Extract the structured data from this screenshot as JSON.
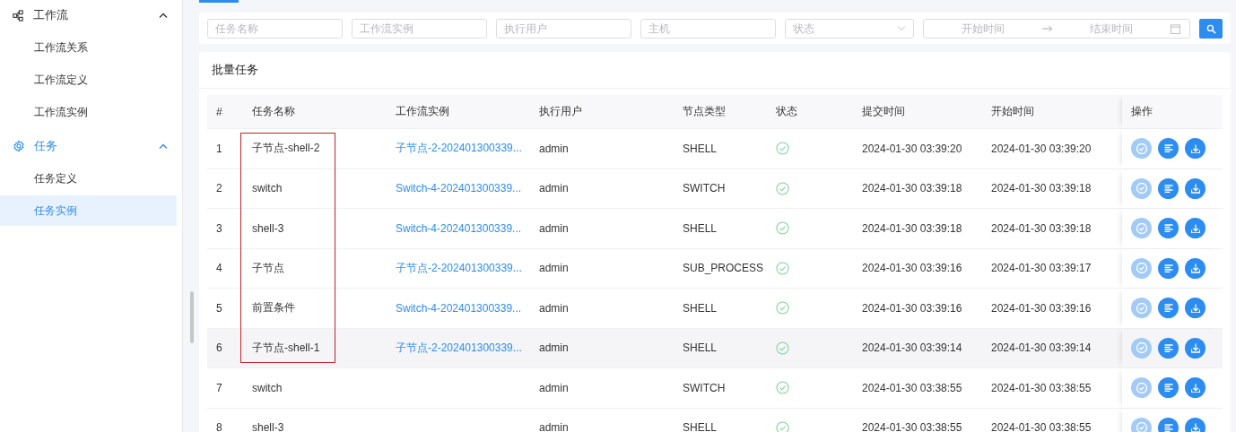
{
  "sidebar": {
    "groups": [
      {
        "label": "工作流",
        "expanded": true,
        "active": false,
        "children": [
          {
            "label": "工作流关系",
            "selected": false
          },
          {
            "label": "工作流定义",
            "selected": false
          },
          {
            "label": "工作流实例",
            "selected": false
          }
        ]
      },
      {
        "label": "任务",
        "expanded": true,
        "active": true,
        "children": [
          {
            "label": "任务定义",
            "selected": false
          },
          {
            "label": "任务实例",
            "selected": true
          }
        ]
      }
    ]
  },
  "filters": [
    {
      "kind": "text",
      "placeholder": "任务名称"
    },
    {
      "kind": "text",
      "placeholder": "工作流实例"
    },
    {
      "kind": "text",
      "placeholder": "执行用户"
    },
    {
      "kind": "text",
      "placeholder": "主机"
    },
    {
      "kind": "select",
      "placeholder": "状态"
    },
    {
      "kind": "daterange",
      "start_placeholder": "开始时间",
      "end_placeholder": "结束时间"
    }
  ],
  "table": {
    "title": "批量任务",
    "columns": [
      {
        "kind": "text",
        "label": "#"
      },
      {
        "kind": "text",
        "label": "任务名称"
      },
      {
        "kind": "text",
        "label": "工作流实例"
      },
      {
        "kind": "text",
        "label": "执行用户"
      },
      {
        "kind": "text",
        "label": "节点类型"
      },
      {
        "kind": "text",
        "label": "状态"
      },
      {
        "kind": "text",
        "label": "提交时间"
      },
      {
        "kind": "text",
        "label": "开始时间"
      },
      {
        "kind": "clipped"
      },
      {
        "kind": "text",
        "label": "操作"
      }
    ],
    "rows": [
      {
        "index": "1",
        "name": "子节点-shell-2",
        "instance": "子节点-2-202401300339...",
        "user": "admin",
        "node_type": "SHELL",
        "success": true,
        "submit_time": "2024-01-30 03:39:20",
        "start_time": "2024-01-30 03:39:20",
        "marked": true,
        "hovered": false,
        "actions": [
          {
            "kind": "confirm",
            "disabled": true
          },
          {
            "kind": "log",
            "disabled": false
          },
          {
            "kind": "download",
            "disabled": false
          }
        ]
      },
      {
        "index": "2",
        "name": "switch",
        "instance": "Switch-4-202401300339...",
        "user": "admin",
        "node_type": "SWITCH",
        "success": true,
        "submit_time": "2024-01-30 03:39:18",
        "start_time": "2024-01-30 03:39:18",
        "marked": true,
        "hovered": false,
        "actions": [
          {
            "kind": "confirm",
            "disabled": true
          },
          {
            "kind": "log",
            "disabled": false
          },
          {
            "kind": "download",
            "disabled": false
          }
        ]
      },
      {
        "index": "3",
        "name": "shell-3",
        "instance": "Switch-4-202401300339...",
        "user": "admin",
        "node_type": "SHELL",
        "success": true,
        "submit_time": "2024-01-30 03:39:18",
        "start_time": "2024-01-30 03:39:18",
        "marked": true,
        "hovered": false,
        "actions": [
          {
            "kind": "confirm",
            "disabled": true
          },
          {
            "kind": "log",
            "disabled": false
          },
          {
            "kind": "download",
            "disabled": false
          }
        ]
      },
      {
        "index": "4",
        "name": "子节点",
        "instance": "子节点-2-202401300339...",
        "user": "admin",
        "node_type": "SUB_PROCESS",
        "success": true,
        "submit_time": "2024-01-30 03:39:16",
        "start_time": "2024-01-30 03:39:17",
        "marked": true,
        "hovered": false,
        "actions": [
          {
            "kind": "confirm",
            "disabled": true
          },
          {
            "kind": "log",
            "disabled": false
          },
          {
            "kind": "download",
            "disabled": false
          }
        ]
      },
      {
        "index": "5",
        "name": "前置条件",
        "instance": "Switch-4-202401300339...",
        "user": "admin",
        "node_type": "SHELL",
        "success": true,
        "submit_time": "2024-01-30 03:39:16",
        "start_time": "2024-01-30 03:39:16",
        "marked": true,
        "hovered": false,
        "actions": [
          {
            "kind": "confirm",
            "disabled": true
          },
          {
            "kind": "log",
            "disabled": false
          },
          {
            "kind": "download",
            "disabled": false
          }
        ]
      },
      {
        "index": "6",
        "name": "子节点-shell-1",
        "instance": "子节点-2-202401300339...",
        "user": "admin",
        "node_type": "SHELL",
        "success": true,
        "submit_time": "2024-01-30 03:39:14",
        "start_time": "2024-01-30 03:39:14",
        "marked": true,
        "hovered": true,
        "actions": [
          {
            "kind": "confirm",
            "disabled": true
          },
          {
            "kind": "log",
            "disabled": false
          },
          {
            "kind": "download",
            "disabled": false
          }
        ]
      },
      {
        "index": "7",
        "name": "switch",
        "user": "admin",
        "node_type": "SWITCH",
        "success": true,
        "submit_time": "2024-01-30 03:38:55",
        "start_time": "2024-01-30 03:38:55",
        "marked": false,
        "hovered": false,
        "actions": [
          {
            "kind": "confirm",
            "disabled": true
          },
          {
            "kind": "log",
            "disabled": false
          },
          {
            "kind": "download",
            "disabled": false
          }
        ]
      },
      {
        "index": "8",
        "name": "shell-3",
        "user": "admin",
        "node_type": "SHELL",
        "success": true,
        "submit_time": "2024-01-30 03:38:55",
        "start_time": "2024-01-30 03:38:55",
        "marked": false,
        "hovered": false,
        "actions": [
          {
            "kind": "confirm",
            "disabled": true
          },
          {
            "kind": "log",
            "disabled": false
          },
          {
            "kind": "download",
            "disabled": false
          }
        ]
      }
    ]
  }
}
